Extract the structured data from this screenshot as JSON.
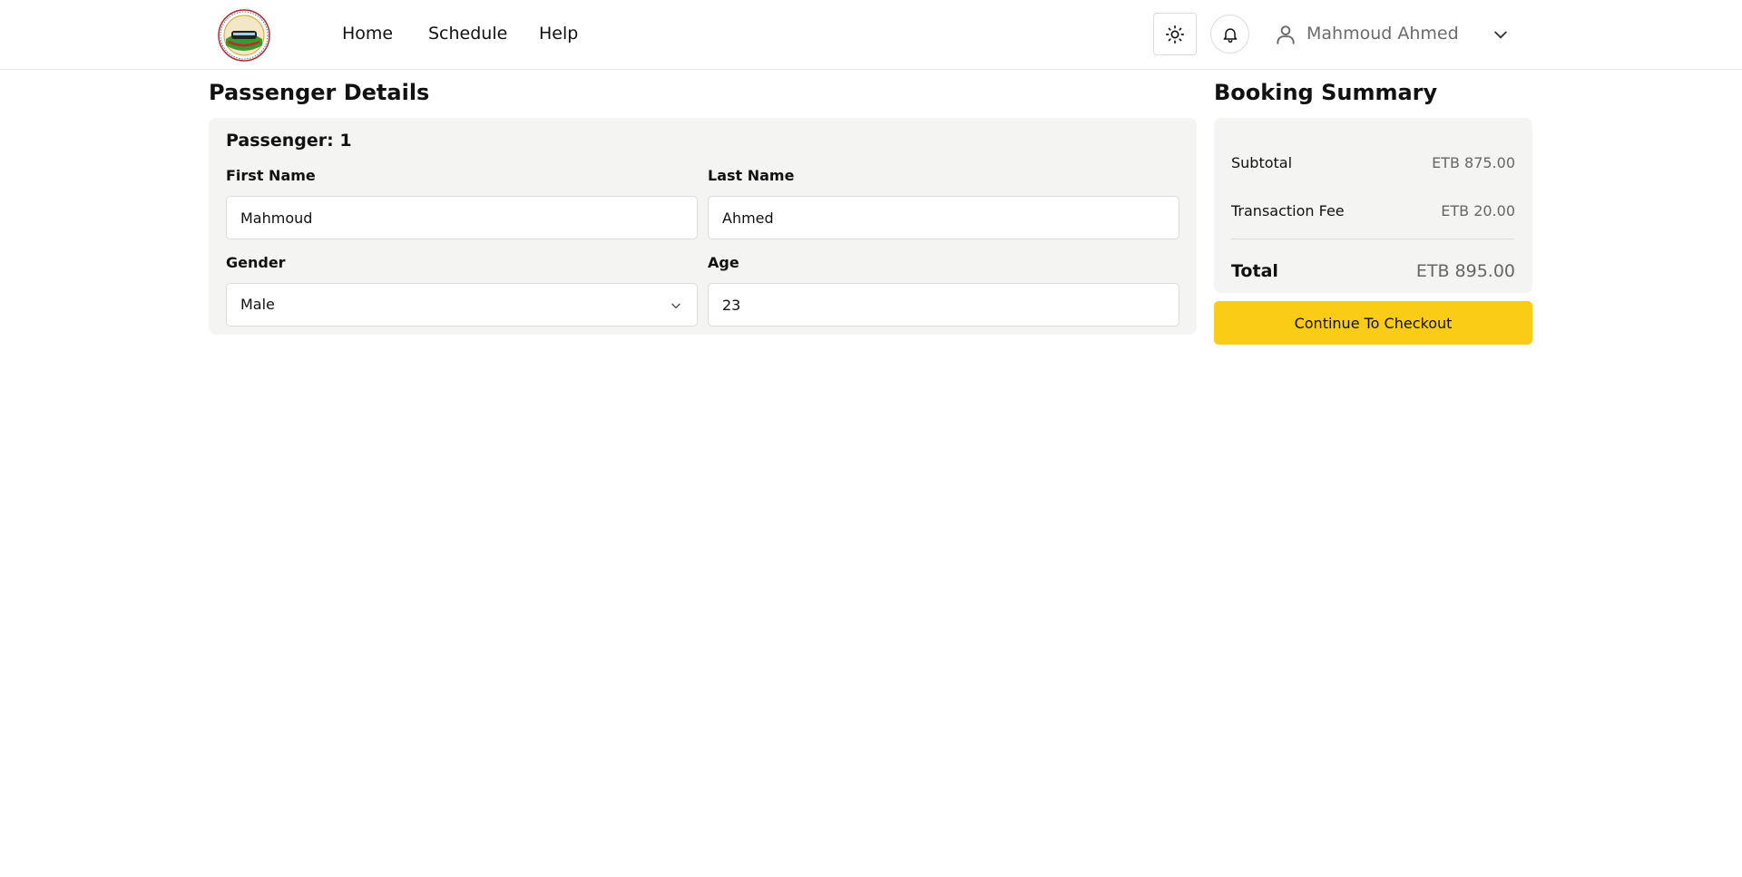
{
  "header": {
    "nav": [
      {
        "label": "Home"
      },
      {
        "label": "Schedule"
      },
      {
        "label": "Help"
      }
    ],
    "user": {
      "name": "Mahmoud Ahmed"
    },
    "icons": {
      "logo": "railway-logo",
      "theme": "sun-icon",
      "notifications": "bell-icon",
      "user": "user-icon",
      "menu": "chevron-down-icon"
    }
  },
  "passenger_details": {
    "title": "Passenger Details",
    "passenger_heading": "Passenger: 1",
    "fields": {
      "first_name": {
        "label": "First Name",
        "value": "Mahmoud"
      },
      "last_name": {
        "label": "Last Name",
        "value": "Ahmed"
      },
      "gender": {
        "label": "Gender",
        "value": "Male"
      },
      "age": {
        "label": "Age",
        "value": "23"
      }
    }
  },
  "booking_summary": {
    "title": "Booking Summary",
    "subtotal": {
      "label": "Subtotal",
      "value": "ETB 875.00"
    },
    "transaction_fee": {
      "label": "Transaction Fee",
      "value": "ETB 20.00"
    },
    "total": {
      "label": "Total",
      "value": "ETB 895.00"
    },
    "checkout_label": "Continue To Checkout"
  },
  "colors": {
    "accent": "#facc15",
    "card_background": "#f4f4f3",
    "muted_text": "#666666"
  }
}
